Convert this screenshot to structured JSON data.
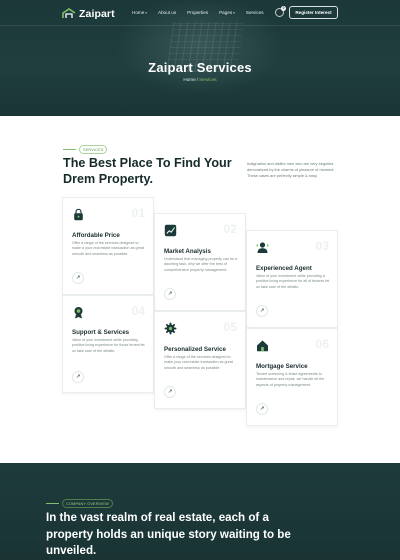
{
  "colors": {
    "brand_dark": "#1d3a3a",
    "accent_green": "#7fbf6a",
    "text_dark": "#162a2b",
    "text_muted": "#7b8888"
  },
  "header": {
    "logo_text": "Zaipart",
    "nav": [
      {
        "label": "Home",
        "dropdown": true
      },
      {
        "label": "About us",
        "dropdown": false
      },
      {
        "label": "Properties",
        "dropdown": false
      },
      {
        "label": "Pages",
        "dropdown": true
      },
      {
        "label": "Services",
        "dropdown": false
      }
    ],
    "cart_count": "0",
    "register_label": "Register Interest"
  },
  "hero": {
    "title": "Zaipart Services",
    "breadcrumb_home": "Home",
    "breadcrumb_sep": "/",
    "breadcrumb_current": "Services"
  },
  "services": {
    "tag": "SERVICES",
    "title": "The Best Place To Find Your Drem Property.",
    "description": "Indignation and dislike men who are very beguiled demoralized by the charms of pleasure of moment. These cases are perfectly simple & easy.",
    "cards": [
      {
        "num": "01",
        "icon": "lock-icon",
        "title": "Affordable Price",
        "text": "Offer a range of the services designed to make a your real estate transaction as great smooth and seamless as possible."
      },
      {
        "num": "02",
        "icon": "chart-icon",
        "title": "Market Analysis",
        "text": "Understand that managing property can be a daunting task, why we offer the best of comprehensive property management."
      },
      {
        "num": "03",
        "icon": "agent-icon",
        "title": "Experienced Agent",
        "text": "Value of your investment while providing a positive living experience for all of tenants let us take care of the details."
      },
      {
        "num": "04",
        "icon": "award-icon",
        "title": "Support & Services",
        "text": "Value of your investment while providing positive living experience for those tenant let us take care of the details."
      },
      {
        "num": "05",
        "icon": "gear-icon",
        "title": "Personalized Service",
        "text": "Offer a range of the services designed to make your real estate transaction as great smooth and seamless as possible."
      },
      {
        "num": "06",
        "icon": "house-icon",
        "title": "Mortgage Service",
        "text": "Tenant screening & lease agreements to maintenance and repair, we handle all the aspects of property management."
      }
    ]
  },
  "overview": {
    "tag": "COMPANY OVERVIEW",
    "title": "In the vast realm of real estate, each of a property holds an unique story waiting to be unveiled."
  }
}
